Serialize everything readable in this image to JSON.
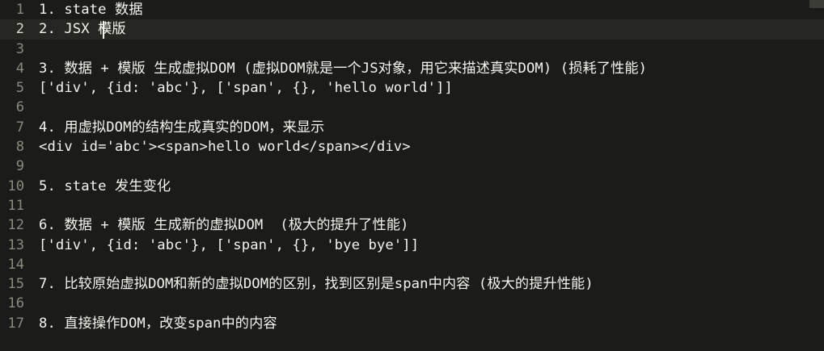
{
  "editor": {
    "current_line": 2,
    "lines": [
      {
        "number": "1",
        "text": "1. state 数据"
      },
      {
        "number": "2",
        "text": "2. JSX 模版"
      },
      {
        "number": "3",
        "text": ""
      },
      {
        "number": "4",
        "text": "3. 数据 + 模版 生成虚拟DOM (虚拟DOM就是一个JS对象，用它来描述真实DOM) (损耗了性能)"
      },
      {
        "number": "5",
        "text": "['div', {id: 'abc'}, ['span', {}, 'hello world']]"
      },
      {
        "number": "6",
        "text": ""
      },
      {
        "number": "7",
        "text": "4. 用虚拟DOM的结构生成真实的DOM，来显示"
      },
      {
        "number": "8",
        "text": "<div id='abc'><span>hello world</span></div>"
      },
      {
        "number": "9",
        "text": ""
      },
      {
        "number": "10",
        "text": "5. state 发生变化"
      },
      {
        "number": "11",
        "text": ""
      },
      {
        "number": "12",
        "text": "6. 数据 + 模版 生成新的虚拟DOM  (极大的提升了性能)"
      },
      {
        "number": "13",
        "text": "['div', {id: 'abc'}, ['span', {}, 'bye bye']]"
      },
      {
        "number": "14",
        "text": ""
      },
      {
        "number": "15",
        "text": "7. 比较原始虚拟DOM和新的虚拟DOM的区别，找到区别是span中内容 (极大的提升性能)"
      },
      {
        "number": "16",
        "text": ""
      },
      {
        "number": "17",
        "text": "8. 直接操作DOM，改变span中的内容"
      }
    ]
  }
}
